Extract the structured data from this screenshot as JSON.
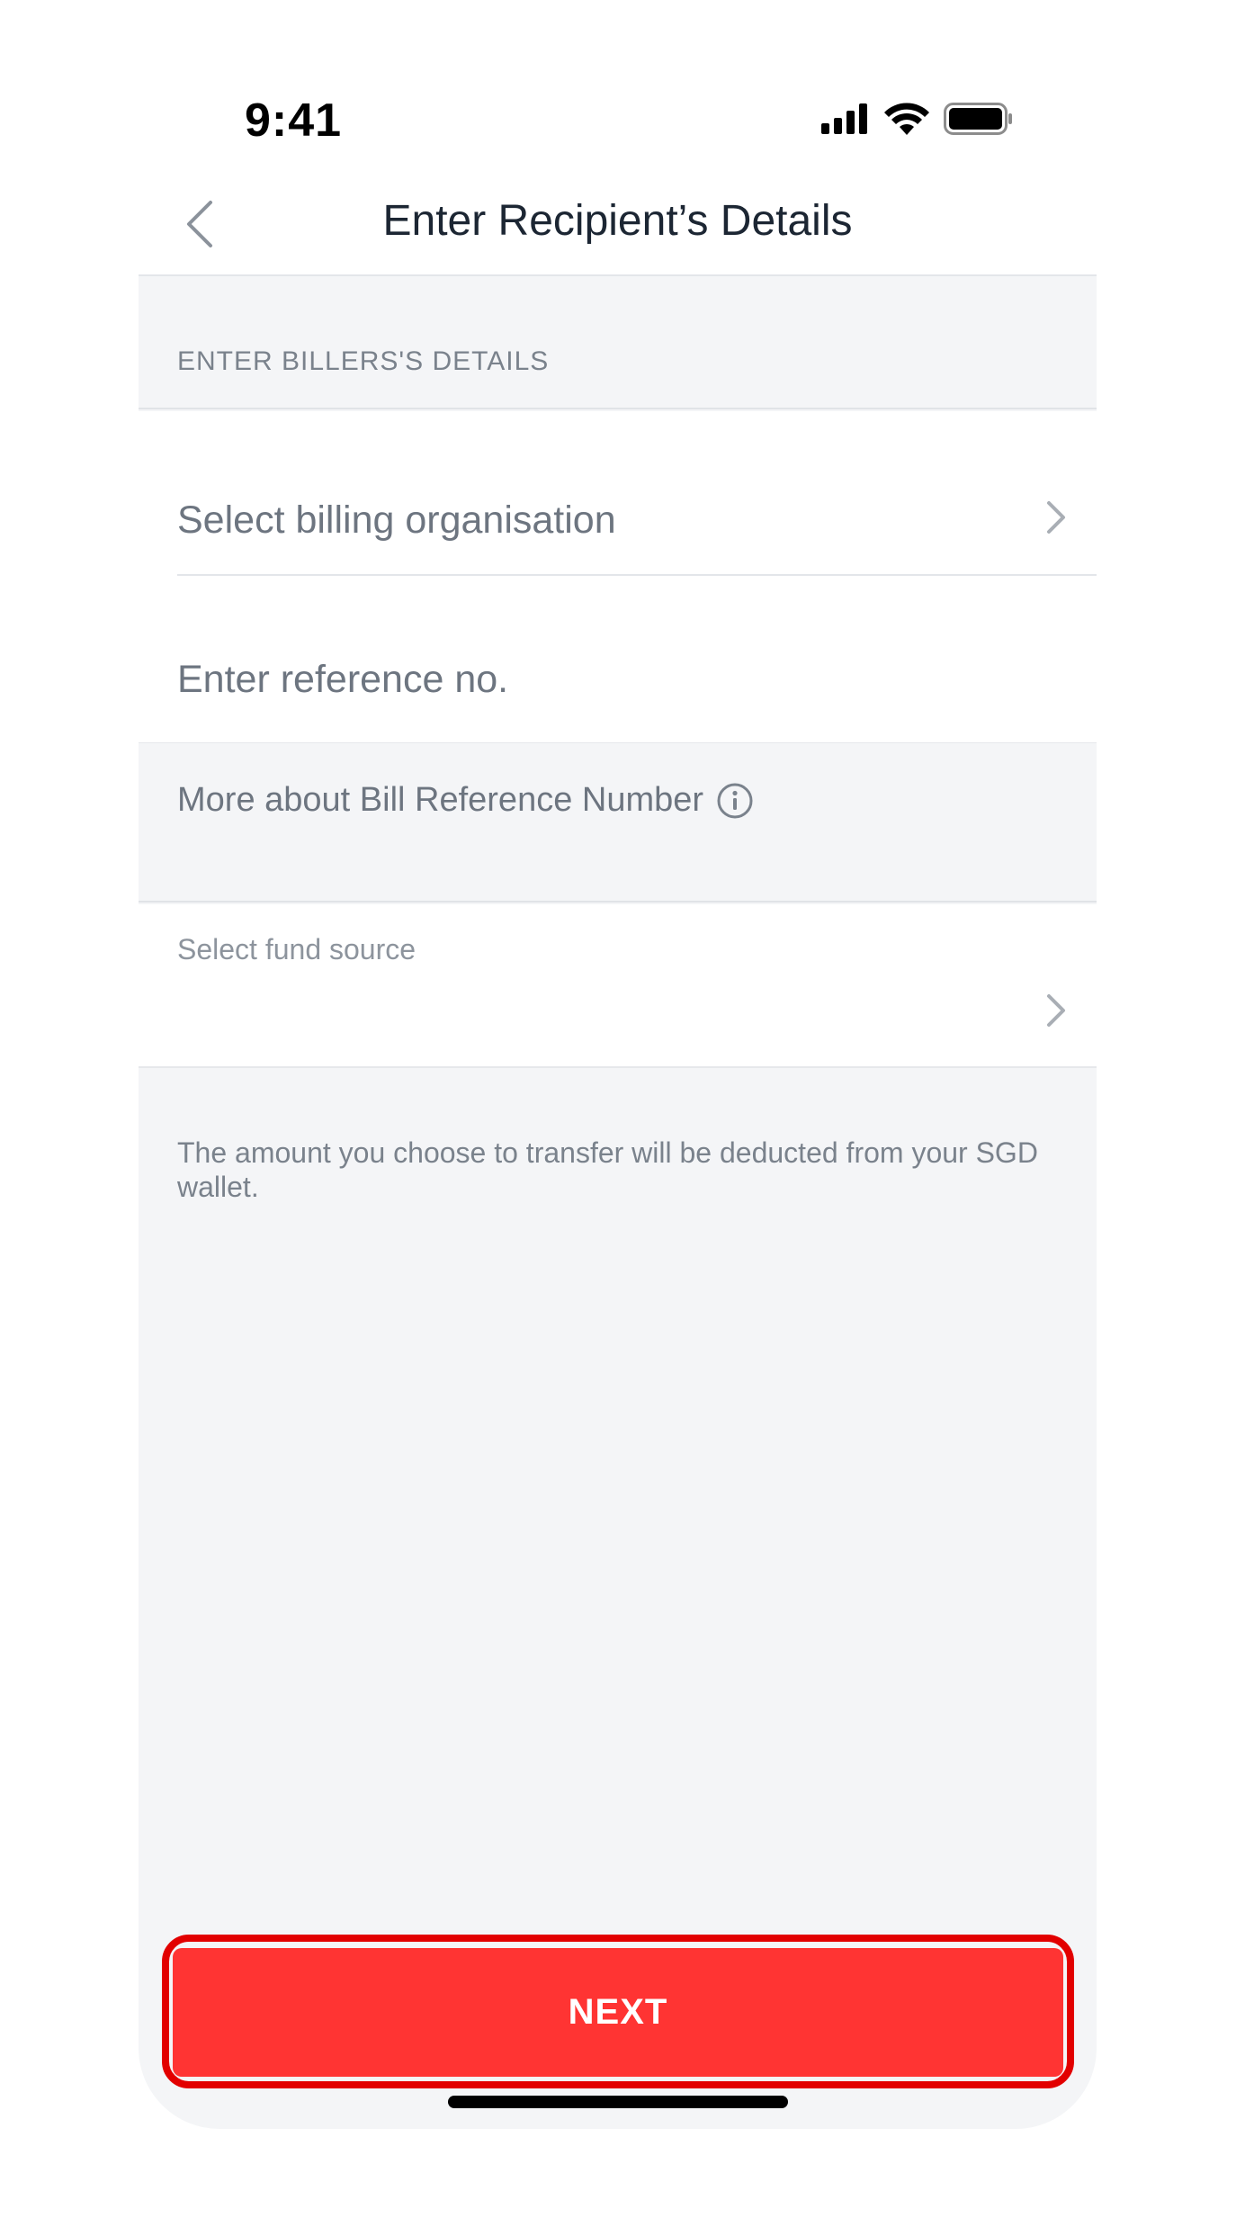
{
  "status_bar": {
    "time": "9:41",
    "icons": [
      "cellular-signal-icon",
      "wifi-icon",
      "battery-icon"
    ]
  },
  "nav": {
    "title": "Enter Recipient’s Details",
    "back_icon": "chevron-left-icon"
  },
  "form": {
    "section_header": "ENTER BILLERS'S DETAILS",
    "billing_org_placeholder": "Select billing organisation",
    "reference_placeholder": "Enter reference no.",
    "reference_value": "",
    "more_info_label": "More about Bill Reference Number",
    "more_info_icon": "info-icon",
    "fund_source_label": "Select fund source",
    "fund_source_value": "",
    "wallet_note": "The amount you choose to transfer will be deducted from your SGD wallet."
  },
  "actions": {
    "next_label": "NEXT"
  },
  "colors": {
    "primary": "#ff3433",
    "highlight": "#e20000",
    "background": "#f4f5f7",
    "text_primary": "#1c2633",
    "text_secondary": "#6d7580"
  }
}
